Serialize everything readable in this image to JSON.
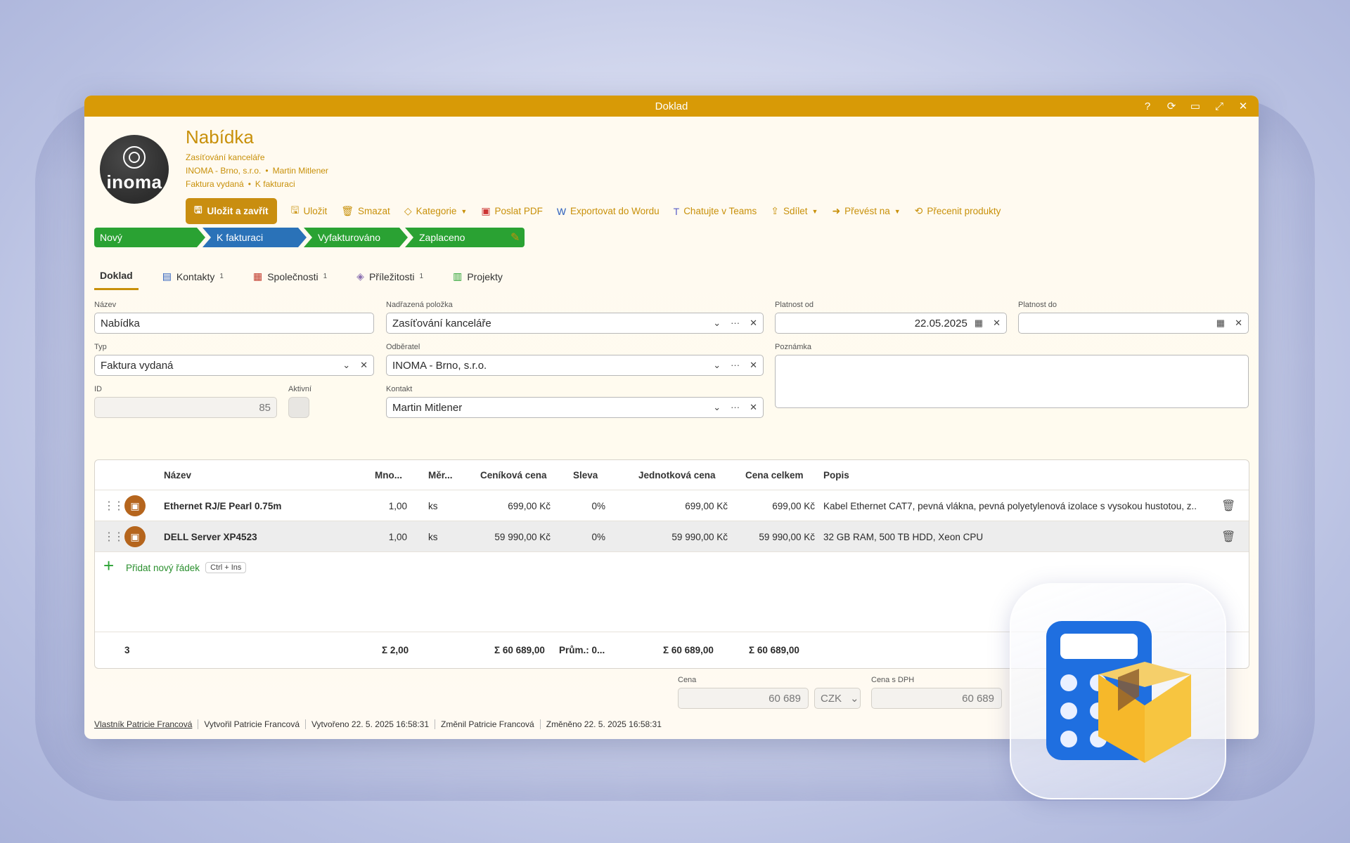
{
  "window": {
    "title": "Doklad"
  },
  "logo": {
    "text": "inoma"
  },
  "header": {
    "title": "Nabídka",
    "line1": "Zasíťování kanceláře",
    "line2a": "INOMA - Brno, s.r.o.",
    "line2b": "Martin Mitlener",
    "line3a": "Faktura vydaná",
    "line3b": "K fakturaci"
  },
  "toolbar": {
    "save_close": "Uložit a zavřít",
    "save": "Uložit",
    "delete": "Smazat",
    "category": "Kategorie",
    "send_pdf": "Poslat PDF",
    "export_word": "Exportovat do Wordu",
    "teams": "Chatujte v Teams",
    "share": "Sdílet",
    "convert": "Převést na",
    "reprice": "Přecenit produkty"
  },
  "pipeline": [
    "Nový",
    "K fakturaci",
    "Vyfakturováno",
    "Zaplaceno"
  ],
  "tabs": [
    {
      "label": "Doklad"
    },
    {
      "label": "Kontakty",
      "count": "1"
    },
    {
      "label": "Společnosti",
      "count": "1"
    },
    {
      "label": "Příležitosti",
      "count": "1"
    },
    {
      "label": "Projekty"
    }
  ],
  "form": {
    "name_label": "Název",
    "name_value": "Nabídka",
    "parent_label": "Nadřazená položka",
    "parent_value": "Zasíťování kanceláře",
    "valid_from_label": "Platnost od",
    "valid_from_value": "22.05.2025",
    "valid_to_label": "Platnost do",
    "valid_to_value": "",
    "type_label": "Typ",
    "type_value": "Faktura vydaná",
    "customer_label": "Odběratel",
    "customer_value": "INOMA - Brno, s.r.o.",
    "note_label": "Poznámka",
    "id_label": "ID",
    "id_value": "85",
    "active_label": "Aktivní",
    "contact_label": "Kontakt",
    "contact_value": "Martin Mitlener"
  },
  "grid": {
    "headers": [
      "Název",
      "Mno...",
      "Měr...",
      "Ceníková cena",
      "Sleva",
      "Jednotková cena",
      "Cena celkem",
      "Popis"
    ],
    "rows": [
      {
        "name": "Ethernet RJ/E Pearl 0.75m",
        "qty": "1,00",
        "unit": "ks",
        "list_price": "699,00 Kč",
        "discount": "0%",
        "unit_price": "699,00 Kč",
        "total": "699,00 Kč",
        "desc": "Kabel Ethernet CAT7, pevná vlákna, pevná polyetylenová izolace s vysokou hustotou, z..."
      },
      {
        "name": "DELL Server XP4523",
        "qty": "1,00",
        "unit": "ks",
        "list_price": "59 990,00 Kč",
        "discount": "0%",
        "unit_price": "59 990,00 Kč",
        "total": "59 990,00 Kč",
        "desc": "32 GB RAM, 500 TB HDD, Xeon CPU"
      }
    ],
    "add_row": "Přidat nový řádek",
    "add_shortcut": "Ctrl + Ins",
    "footer": {
      "count": "3",
      "qty": "Σ 2,00",
      "list": "Σ 60 689,00",
      "discount": "Prům.: 0...",
      "unit": "Σ 60 689,00",
      "total": "Σ 60 689,00"
    }
  },
  "price": {
    "price_label": "Cena",
    "price_value": "60 689",
    "currency": "CZK",
    "vat_label": "Cena s DPH",
    "vat_value": "60 689"
  },
  "footer": {
    "owner": "Vlastník Patricie Francová",
    "created_by": "Vytvořil Patricie Francová",
    "created": "Vytvořeno 22. 5. 2025 16:58:31",
    "changed_by": "Změnil Patricie Francová",
    "changed": "Změněno 22. 5. 2025 16:58:31"
  },
  "colors": {
    "accent": "#d89a06",
    "green": "#2aa233",
    "blue": "#2a72b8"
  }
}
